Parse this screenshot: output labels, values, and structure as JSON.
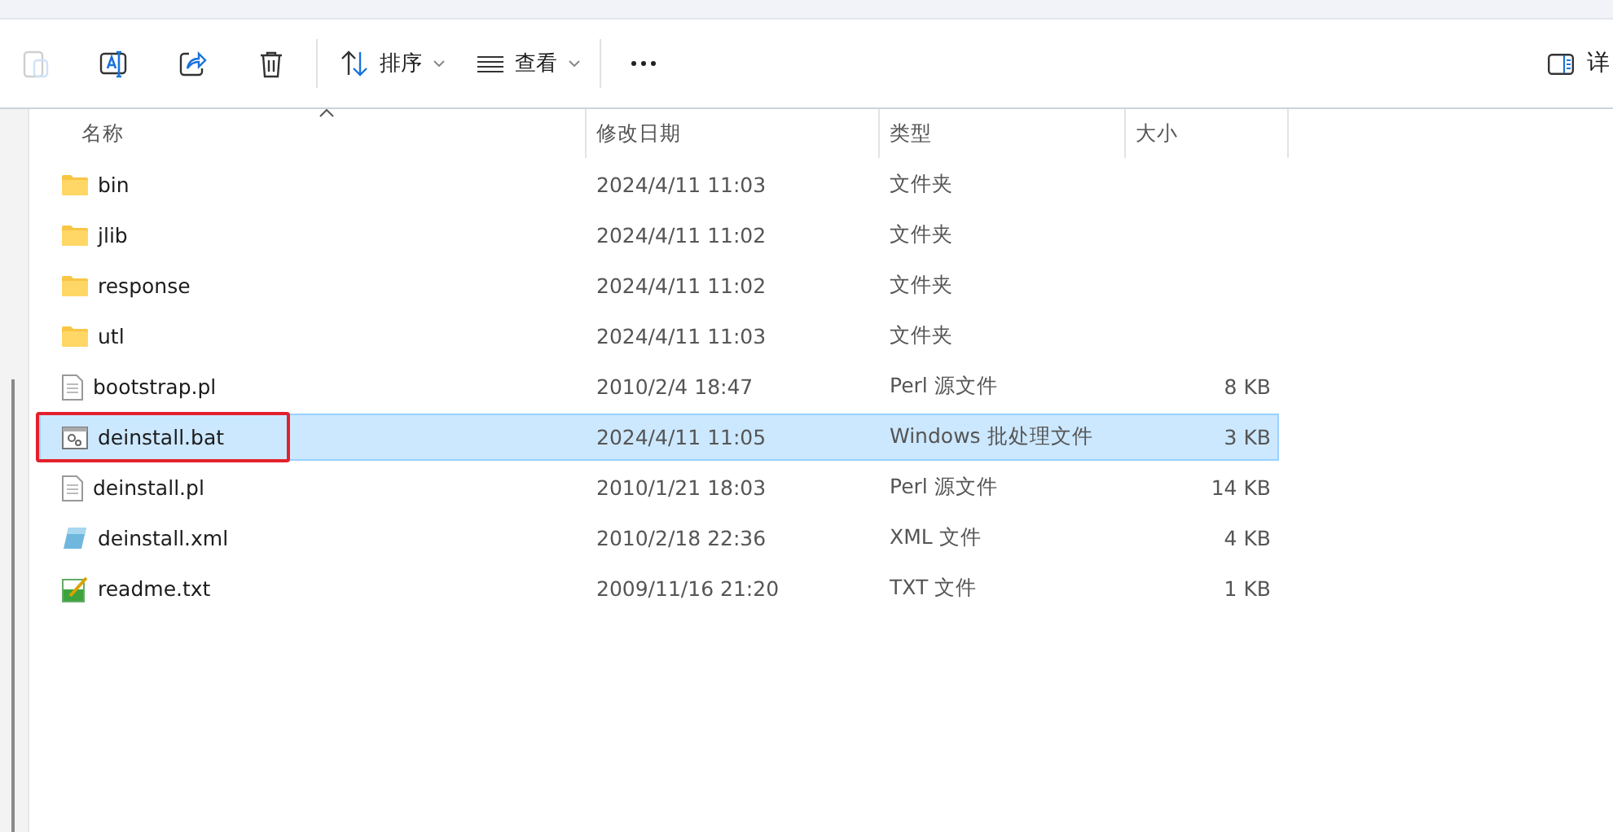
{
  "toolbar": {
    "buttons": [
      {
        "kind": "paste",
        "disabled": true
      },
      {
        "kind": "rename",
        "disabled": false
      },
      {
        "kind": "share",
        "disabled": false
      },
      {
        "kind": "delete",
        "disabled": false
      },
      {
        "kind": "sort",
        "label": "排序",
        "disabled": false
      },
      {
        "kind": "view",
        "label": "查看",
        "disabled": false
      },
      {
        "kind": "more",
        "disabled": false
      }
    ],
    "details": {
      "label": "详"
    }
  },
  "table": {
    "columns": [
      {
        "label": "名称",
        "sorted": true
      },
      {
        "label": "修改日期",
        "sorted": false
      },
      {
        "label": "类型",
        "sorted": false
      },
      {
        "label": "大小",
        "sorted": false
      }
    ],
    "rows": [
      {
        "kind": "folder",
        "name": "bin",
        "date": "2024/4/11 11:03",
        "type": "文件夹",
        "selected": false,
        "annotated": false
      },
      {
        "kind": "folder",
        "name": "jlib",
        "date": "2024/4/11 11:02",
        "type": "文件夹",
        "selected": false,
        "annotated": false
      },
      {
        "kind": "folder",
        "name": "response",
        "date": "2024/4/11 11:02",
        "type": "文件夹",
        "selected": false,
        "annotated": false
      },
      {
        "kind": "folder",
        "name": "utl",
        "date": "2024/4/11 11:03",
        "type": "文件夹",
        "selected": false,
        "annotated": false
      },
      {
        "kind": "script",
        "name": "bootstrap.pl",
        "date": "2010/2/4 18:47",
        "type": "Perl 源文件",
        "size": "8 KB",
        "selected": false,
        "annotated": false
      },
      {
        "kind": "batch",
        "name": "deinstall.bat",
        "date": "2024/4/11 11:05",
        "type": "Windows 批处理文件",
        "size": "3 KB",
        "selected": true,
        "annotated": true
      },
      {
        "kind": "script",
        "name": "deinstall.pl",
        "date": "2010/1/21 18:03",
        "type": "Perl 源文件",
        "size": "14 KB",
        "selected": false,
        "annotated": false
      },
      {
        "kind": "xml",
        "name": "deinstall.xml",
        "date": "2010/2/18 22:36",
        "type": "XML 文件",
        "size": "4 KB",
        "selected": false,
        "annotated": false
      },
      {
        "kind": "text",
        "name": "readme.txt",
        "date": "2009/11/16 21:20",
        "type": "TXT 文件",
        "size": "1 KB",
        "selected": false,
        "annotated": false
      }
    ]
  }
}
